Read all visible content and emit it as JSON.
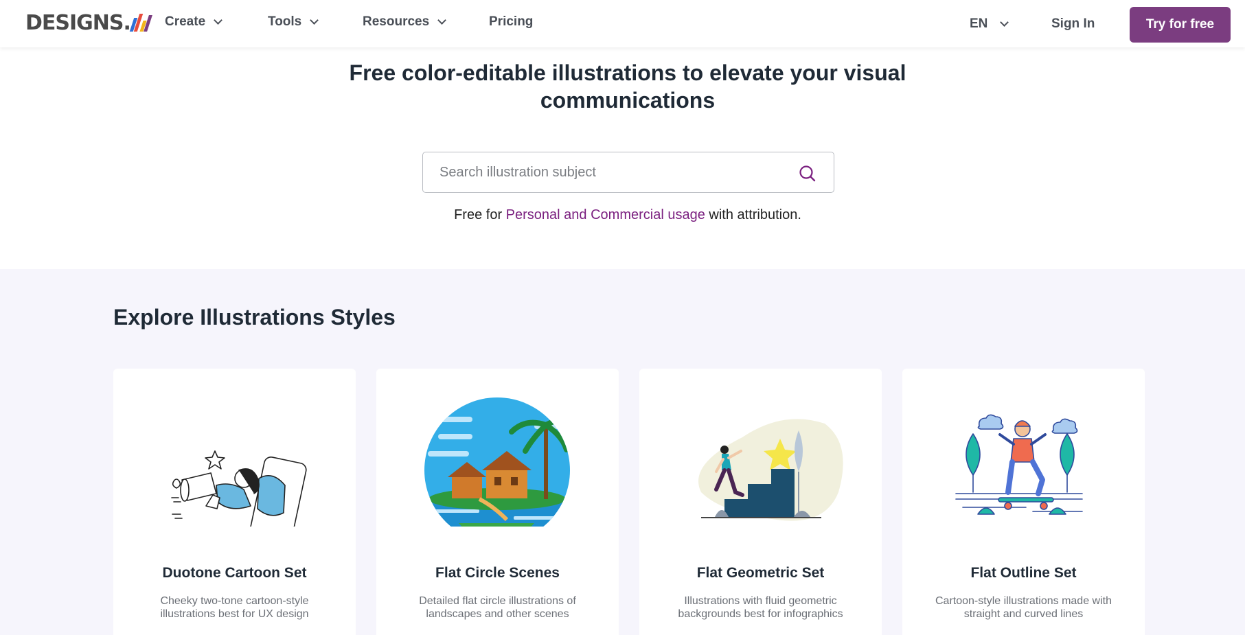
{
  "header": {
    "logo_text": "DESIGNS.",
    "logo_colors": [
      "#2f6fd6",
      "#e84c3d",
      "#f3b51b",
      "#7b3d80"
    ],
    "nav": [
      {
        "label": "Create",
        "dropdown": true
      },
      {
        "label": "Tools",
        "dropdown": true
      },
      {
        "label": "Resources",
        "dropdown": true
      },
      {
        "label": "Pricing",
        "dropdown": false
      }
    ],
    "language": "EN",
    "sign_in": "Sign In",
    "try_button": "Try for free",
    "accent_color": "#7b3d80"
  },
  "hero": {
    "title": "Free color-editable illustrations to elevate your visual communications",
    "search_placeholder": "Search illustration subject",
    "search_icon": "search-icon",
    "free_prefix": "Free for",
    "free_link": "Personal and Commercial usage",
    "free_suffix": "with attribution."
  },
  "explore": {
    "title": "Explore Illustrations Styles",
    "cards": [
      {
        "title": "Duotone Cartoon Set",
        "description": "Cheeky two-tone cartoon-style illustrations best for UX design",
        "icon": "duotone-cartoon-illustration"
      },
      {
        "title": "Flat Circle Scenes",
        "description": "Detailed flat circle illustrations of landscapes and other scenes",
        "icon": "flat-circle-scene-illustration"
      },
      {
        "title": "Flat Geometric Set",
        "description": "Illustrations with fluid geometric backgrounds best for infographics",
        "icon": "flat-geometric-illustration"
      },
      {
        "title": "Flat Outline Set",
        "description": "Cartoon-style illustrations made with straight and curved lines",
        "icon": "flat-outline-illustration"
      }
    ]
  }
}
